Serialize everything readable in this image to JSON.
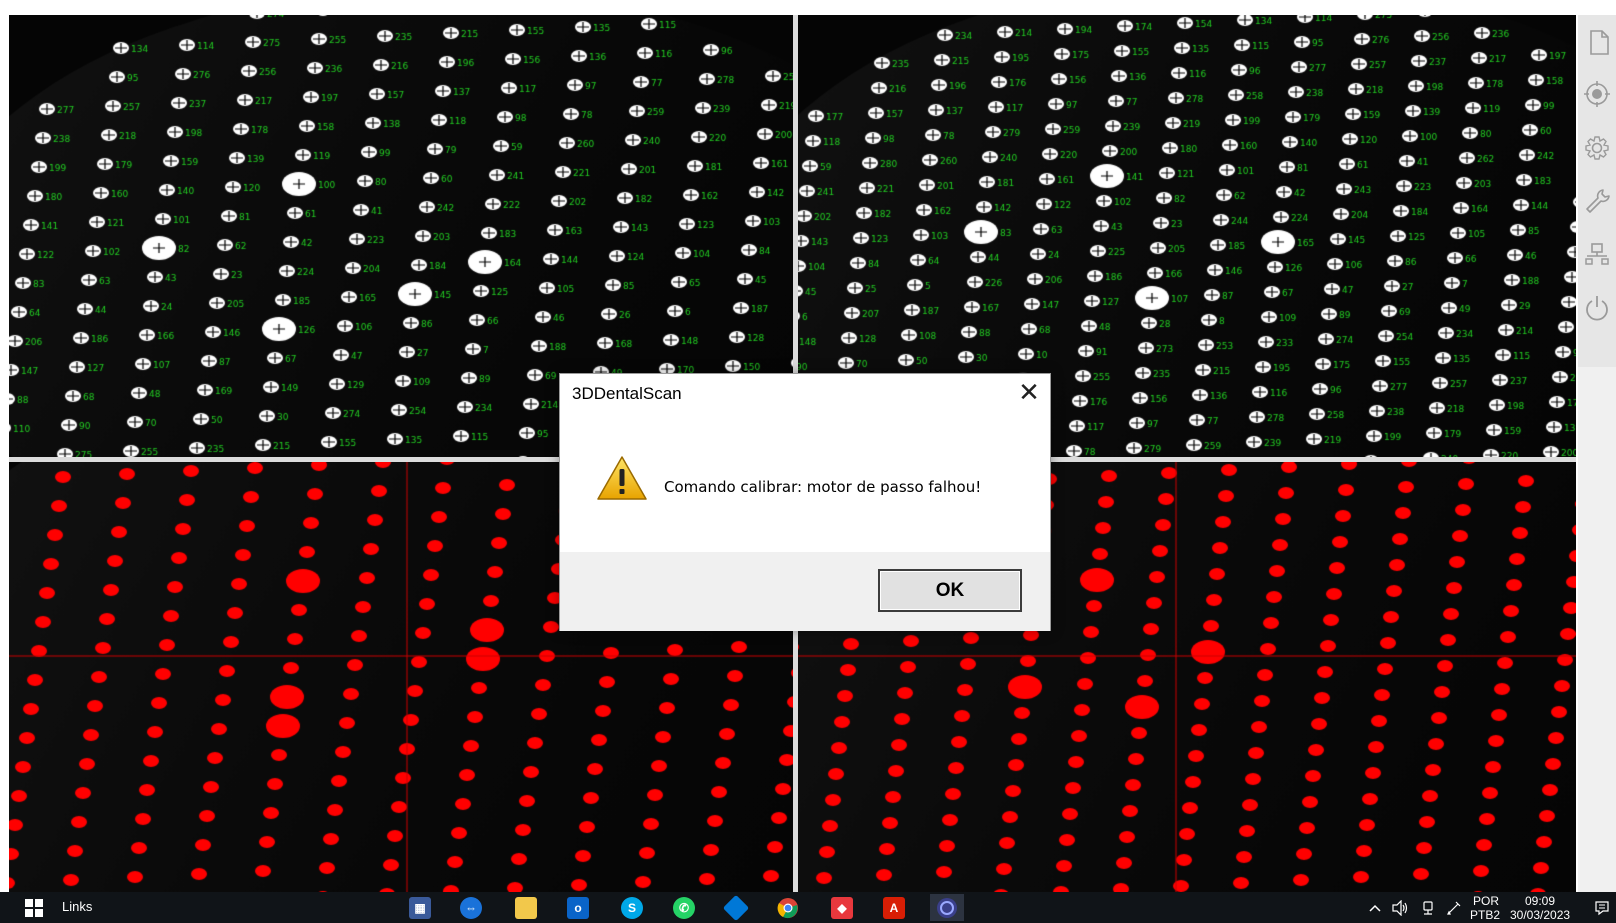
{
  "dialog": {
    "title": "3DDentalScan",
    "message": "Comando calibrar: motor de passo falhou!",
    "ok_label": "OK",
    "close_glyph": "✕",
    "icon": "warning-icon"
  },
  "viewports": {
    "calibration_labels": {
      "top_left": [
        "274",
        "254",
        "234",
        "214",
        "195",
        "154",
        "134",
        "114",
        "275",
        "255",
        "235",
        "215",
        "155",
        "135",
        "115",
        "95",
        "276",
        "256",
        "236",
        "216",
        "196",
        "156",
        "136",
        "116",
        "96",
        "277",
        "257",
        "237",
        "217",
        "197",
        "157",
        "137",
        "117",
        "97",
        "77",
        "278",
        "258",
        "238",
        "218",
        "198",
        "178",
        "158",
        "138",
        "118",
        "98",
        "78",
        "259",
        "239",
        "219",
        "199",
        "179",
        "159",
        "139",
        "119",
        "99",
        "79",
        "59",
        "260",
        "240",
        "220",
        "200",
        "180",
        "160",
        "140",
        "120",
        "100",
        "80",
        "60",
        "241",
        "221",
        "201",
        "181",
        "161",
        "141",
        "121",
        "101",
        "81",
        "61",
        "41",
        "242",
        "222",
        "202",
        "182",
        "162",
        "142",
        "122",
        "102",
        "82",
        "62",
        "42",
        "223",
        "203",
        "183",
        "163",
        "143",
        "123",
        "103",
        "83",
        "63",
        "43",
        "23",
        "224",
        "204",
        "184",
        "164",
        "144",
        "124",
        "104",
        "84",
        "64",
        "44",
        "24",
        "205",
        "185",
        "165",
        "145",
        "125",
        "105",
        "85",
        "65",
        "45",
        "25",
        "206",
        "186",
        "166",
        "146",
        "126",
        "106",
        "86",
        "66",
        "46",
        "26",
        "6",
        "187",
        "167",
        "147",
        "127",
        "107",
        "87",
        "67",
        "47",
        "27",
        "7",
        "188",
        "168",
        "148",
        "128",
        "108",
        "88",
        "68",
        "48",
        "169",
        "149",
        "129",
        "109",
        "89",
        "69",
        "49",
        "170",
        "150",
        "130",
        "110",
        "90",
        "70",
        "50",
        "30"
      ],
      "top_right": [
        "273",
        "253",
        "233",
        "274",
        "254",
        "234",
        "214",
        "194",
        "174",
        "154",
        "134",
        "114",
        "275",
        "255",
        "235",
        "215",
        "195",
        "175",
        "155",
        "135",
        "115",
        "95",
        "276",
        "256",
        "236",
        "216",
        "196",
        "176",
        "156",
        "136",
        "116",
        "96",
        "277",
        "257",
        "237",
        "217",
        "197",
        "177",
        "157",
        "137",
        "117",
        "97",
        "77",
        "278",
        "258",
        "238",
        "218",
        "198",
        "178",
        "158",
        "138",
        "118",
        "98",
        "78",
        "279",
        "259",
        "239",
        "219",
        "199",
        "179",
        "159",
        "139",
        "119",
        "99",
        "79",
        "59",
        "280",
        "260",
        "240",
        "220",
        "200",
        "180",
        "160",
        "140",
        "120",
        "100",
        "80",
        "60",
        "261",
        "241",
        "221",
        "201",
        "181",
        "161",
        "141",
        "121",
        "101",
        "81",
        "61",
        "41",
        "262",
        "242",
        "222",
        "202",
        "182",
        "162",
        "142",
        "122",
        "102",
        "82",
        "62",
        "42",
        "243",
        "223",
        "203",
        "183",
        "163",
        "143",
        "123",
        "103",
        "83",
        "63",
        "43",
        "23",
        "244",
        "224",
        "204",
        "184",
        "164",
        "144",
        "124",
        "104",
        "84",
        "64",
        "44",
        "24",
        "225",
        "205",
        "185",
        "165",
        "145",
        "125",
        "105",
        "85",
        "65",
        "45",
        "25",
        "5",
        "226",
        "206",
        "186",
        "166",
        "146",
        "126",
        "106",
        "86",
        "66",
        "46",
        "26",
        "6",
        "207",
        "187",
        "167",
        "147",
        "127",
        "107",
        "87",
        "67",
        "47",
        "27",
        "7",
        "188",
        "168",
        "148",
        "128",
        "108",
        "88",
        "68",
        "48",
        "28",
        "8",
        "109",
        "89",
        "69",
        "49",
        "29",
        "9",
        "90",
        "70",
        "50",
        "30",
        "10",
        "91"
      ]
    },
    "colors": {
      "background": "#050505",
      "dot_white": "#ffffff",
      "dot_red": "#ff0000",
      "label_green": "#22cc22",
      "crosshair_red": "#cc0000",
      "divider": "#dcdcdc"
    }
  },
  "toolbar": {
    "items": [
      "new-document-icon",
      "target-icon",
      "settings-gear-icon",
      "wrench-icon",
      "network-icon",
      "power-icon"
    ]
  },
  "taskbar": {
    "links_label": "Links",
    "apps": [
      "calculator-icon",
      "teamviewer-icon",
      "file-explorer-icon",
      "outlook-icon",
      "skype-icon",
      "whatsapp-icon",
      "app-blue-icon",
      "chrome-icon",
      "anydesk-icon",
      "acrobat-icon",
      "scanner-app-icon"
    ],
    "language_top": "POR",
    "language_bottom": "PTB2",
    "time": "09:09",
    "date": "30/03/2023",
    "colors": {
      "bar": "#101418",
      "text": "#ffffff"
    }
  }
}
